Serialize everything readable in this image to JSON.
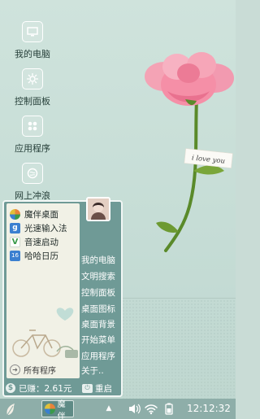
{
  "desktop": {
    "icons": [
      {
        "label": "我的电脑",
        "icon": "computer-icon"
      },
      {
        "label": "控制面板",
        "icon": "control-panel-icon"
      },
      {
        "label": "应用程序",
        "icon": "apps-icon"
      },
      {
        "label": "网上冲浪",
        "icon": "browser-icon"
      }
    ],
    "wallpaper_tag_text": "i love you"
  },
  "start_menu": {
    "apps": [
      {
        "label": "魔伴桌面",
        "icon": "mojie-desktop-icon",
        "color": "#e8833a"
      },
      {
        "label": "光速输入法",
        "icon": "input-method-icon",
        "color": "#3a7fd0"
      },
      {
        "label": "音速启动",
        "icon": "quick-launch-icon",
        "color": "#3a9a4a"
      },
      {
        "label": "哈哈日历",
        "icon": "calendar-icon",
        "color": "#3a7fd0"
      }
    ],
    "all_programs_label": "所有程序",
    "links": [
      "我的电脑",
      "文明搜索",
      "控制面板",
      "桌面图标",
      "桌面背景",
      "开始菜单",
      "应用程序",
      "关于.."
    ],
    "earned_label": "已赚：2.61元",
    "restart_label": "重启"
  },
  "taskbar": {
    "running_app_label": "魔伴",
    "clock": "12:12:32"
  },
  "colors": {
    "menu_bg": "#6f9a96",
    "taskbar_bg": "#8eaea9",
    "wallpaper": "#c9dcd6"
  }
}
